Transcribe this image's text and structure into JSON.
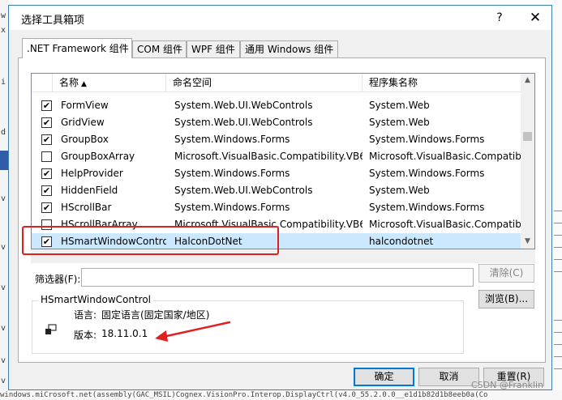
{
  "dialog": {
    "title": "选择工具箱项",
    "help_label": "?",
    "close_label": "✕"
  },
  "tabs": [
    {
      "label": ".NET Framework 组件",
      "active": true
    },
    {
      "label": "COM 组件",
      "active": false
    },
    {
      "label": "WPF 组件",
      "active": false
    },
    {
      "label": "通用 Windows 组件",
      "active": false
    }
  ],
  "list": {
    "columns": {
      "name": "名称",
      "namespace": "命名空间",
      "assembly": "程序集名称"
    },
    "sort_indicator": "▲",
    "rows": [
      {
        "checked": true,
        "name": "FormView",
        "namespace": "System.Web.UI.WebControls",
        "assembly": "System.Web"
      },
      {
        "checked": true,
        "name": "GridView",
        "namespace": "System.Web.UI.WebControls",
        "assembly": "System.Web"
      },
      {
        "checked": true,
        "name": "GroupBox",
        "namespace": "System.Windows.Forms",
        "assembly": "System.Windows.Forms"
      },
      {
        "checked": false,
        "name": "GroupBoxArray",
        "namespace": "Microsoft.VisualBasic.Compatibility.VB6",
        "assembly": "Microsoft.VisualBasic.Compatibi"
      },
      {
        "checked": true,
        "name": "HelpProvider",
        "namespace": "System.Windows.Forms",
        "assembly": "System.Windows.Forms"
      },
      {
        "checked": true,
        "name": "HiddenField",
        "namespace": "System.Web.UI.WebControls",
        "assembly": "System.Web"
      },
      {
        "checked": true,
        "name": "HScrollBar",
        "namespace": "System.Windows.Forms",
        "assembly": "System.Windows.Forms"
      },
      {
        "checked": false,
        "name": "HScrollBarArray",
        "namespace": "Microsoft.VisualBasic.Compatibility.VB6",
        "assembly": "Microsoft.VisualBasic.Compatibi"
      },
      {
        "checked": true,
        "selected": true,
        "name": "HSmartWindowContro",
        "namespace": "HalconDotNet",
        "assembly": "halcondotnet"
      }
    ]
  },
  "filter": {
    "label": "筛选器(F):",
    "value": "",
    "clear_label": "清除(C)"
  },
  "browse_label": "浏览(B)...",
  "details": {
    "group_title": "HSmartWindowControl",
    "language_label": "语言:",
    "language_value": "固定语言(固定国家/地区)",
    "version_label": "版本:",
    "version_value": "18.11.0.1"
  },
  "buttons": {
    "ok": "确定",
    "cancel": "取消",
    "reset": "重置(R)"
  },
  "watermark": "CSDN @Franklin",
  "background": {
    "bottom_text": "windows.miCrosoft.net(assembly(GAC_MSIL)Cognex.VisionPro.Interop.DisplayCtrl(v4.0_55.2.0.0__e1d1b82d1b8eeb0a(Co",
    "left_marks": [
      "w",
      "x",
      "i",
      "d",
      "v",
      "v",
      "v",
      "v",
      "v",
      "v"
    ]
  },
  "colors": {
    "accent": "#0078d7",
    "selection": "#cce8ff",
    "annotation_red": "#e02020"
  }
}
